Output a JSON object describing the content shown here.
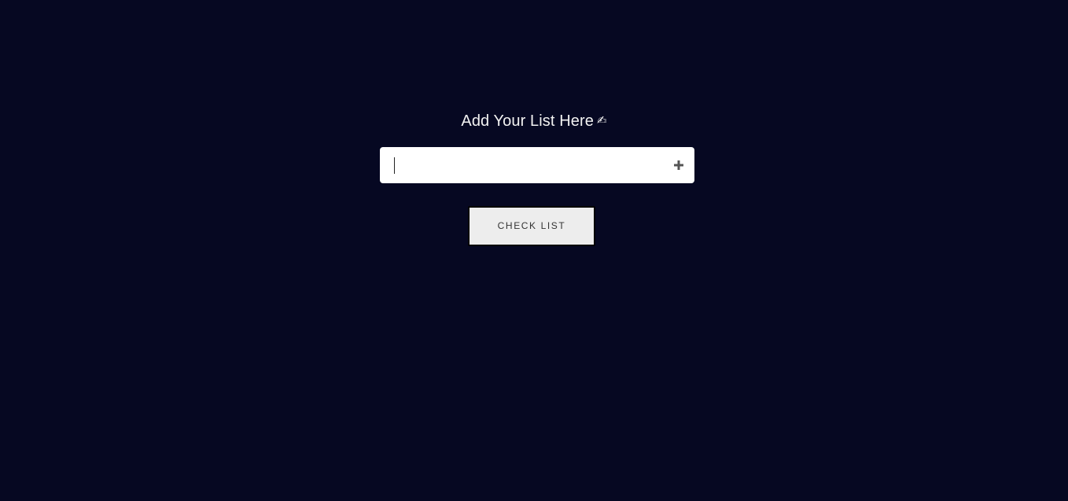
{
  "page": {
    "background_color": "#060822"
  },
  "heading": {
    "text": "Add Your List Here",
    "emoji": "✍"
  },
  "input": {
    "value": "",
    "placeholder": "",
    "add_icon": "plus-icon"
  },
  "button": {
    "label": "CHECK LIST"
  }
}
